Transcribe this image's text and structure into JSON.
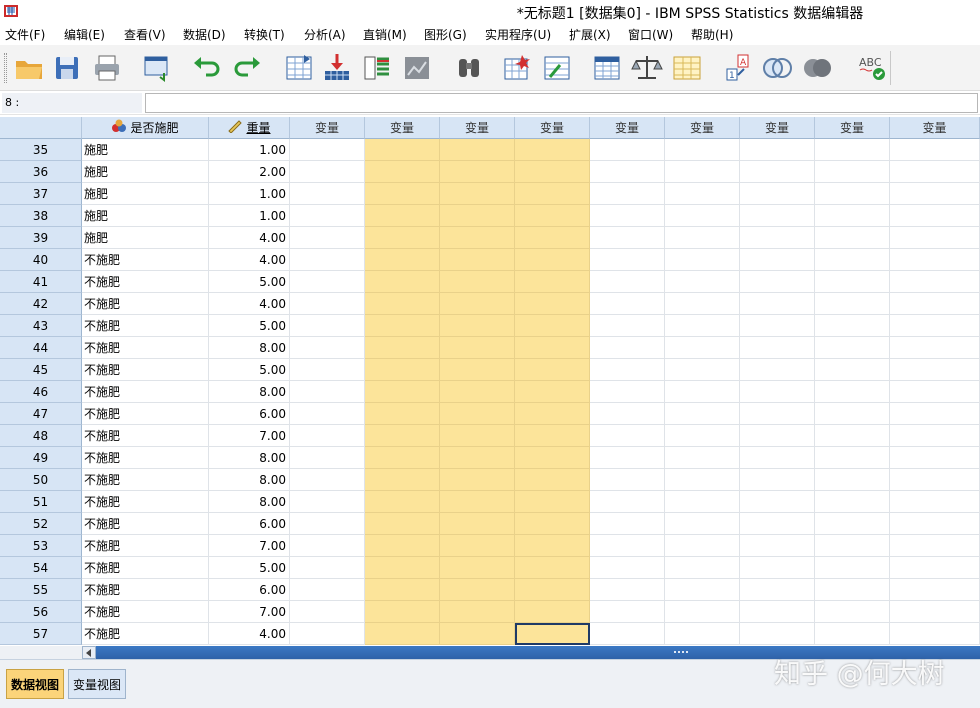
{
  "window": {
    "title": "*无标题1 [数据集0] - IBM SPSS Statistics 数据编辑器"
  },
  "menu": [
    {
      "label": "文件(F)",
      "underline_char": "F"
    },
    {
      "label": "编辑(E)",
      "underline_char": "E"
    },
    {
      "label": "查看(V)",
      "underline_char": "V"
    },
    {
      "label": "数据(D)",
      "underline_char": "D"
    },
    {
      "label": "转换(T)",
      "underline_char": "T"
    },
    {
      "label": "分析(A)",
      "underline_char": "A"
    },
    {
      "label": "直销(M)",
      "underline_char": "M"
    },
    {
      "label": "图形(G)",
      "underline_char": "G"
    },
    {
      "label": "实用程序(U)",
      "underline_char": "U"
    },
    {
      "label": "扩展(X)",
      "underline_char": "X"
    },
    {
      "label": "窗口(W)",
      "underline_char": "W"
    },
    {
      "label": "帮助(H)",
      "underline_char": "H"
    }
  ],
  "toolbar": {
    "buttons": [
      {
        "name": "open-folder-icon"
      },
      {
        "name": "save-disk-icon"
      },
      {
        "name": "print-icon"
      },
      {
        "name": "recall-dialog-icon"
      },
      {
        "name": "undo-icon"
      },
      {
        "name": "redo-icon"
      },
      {
        "name": "goto-case-icon"
      },
      {
        "name": "goto-variable-icon"
      },
      {
        "name": "variables-icon"
      },
      {
        "name": "run-descriptives-icon"
      },
      {
        "name": "find-binoculars-icon"
      },
      {
        "name": "insert-cases-icon"
      },
      {
        "name": "insert-variable-icon"
      },
      {
        "name": "split-file-icon"
      },
      {
        "name": "weight-cases-scale-icon"
      },
      {
        "name": "select-cases-icon"
      },
      {
        "name": "value-labels-icon"
      },
      {
        "name": "use-variable-sets-icon"
      },
      {
        "name": "show-all-variables-icon"
      },
      {
        "name": "spell-check-icon"
      }
    ]
  },
  "cellbar": {
    "reference": "8 :",
    "value": ""
  },
  "grid": {
    "columns": [
      {
        "label": "是否施肥",
        "kind": "nominal",
        "icon": "nominal-variable-icon"
      },
      {
        "label": "重量",
        "kind": "scale",
        "icon": "scale-ruler-icon",
        "underline": true
      },
      {
        "label": "变量"
      },
      {
        "label": "变量"
      },
      {
        "label": "变量"
      },
      {
        "label": "变量"
      },
      {
        "label": "变量"
      },
      {
        "label": "变量"
      },
      {
        "label": "变量"
      },
      {
        "label": "变量"
      },
      {
        "label": "变量"
      }
    ],
    "highlighted_columns": [
      3,
      4,
      5
    ],
    "highlight_color": "#fce49a",
    "selected_cell": {
      "row": 57,
      "col": 5
    },
    "rows": [
      {
        "n": "35",
        "fert": "施肥",
        "weight": "1.00"
      },
      {
        "n": "36",
        "fert": "施肥",
        "weight": "2.00"
      },
      {
        "n": "37",
        "fert": "施肥",
        "weight": "1.00"
      },
      {
        "n": "38",
        "fert": "施肥",
        "weight": "1.00"
      },
      {
        "n": "39",
        "fert": "施肥",
        "weight": "4.00"
      },
      {
        "n": "40",
        "fert": "不施肥",
        "weight": "4.00"
      },
      {
        "n": "41",
        "fert": "不施肥",
        "weight": "5.00"
      },
      {
        "n": "42",
        "fert": "不施肥",
        "weight": "4.00"
      },
      {
        "n": "43",
        "fert": "不施肥",
        "weight": "5.00"
      },
      {
        "n": "44",
        "fert": "不施肥",
        "weight": "8.00"
      },
      {
        "n": "45",
        "fert": "不施肥",
        "weight": "5.00"
      },
      {
        "n": "46",
        "fert": "不施肥",
        "weight": "8.00"
      },
      {
        "n": "47",
        "fert": "不施肥",
        "weight": "6.00"
      },
      {
        "n": "48",
        "fert": "不施肥",
        "weight": "7.00"
      },
      {
        "n": "49",
        "fert": "不施肥",
        "weight": "8.00"
      },
      {
        "n": "50",
        "fert": "不施肥",
        "weight": "8.00"
      },
      {
        "n": "51",
        "fert": "不施肥",
        "weight": "8.00"
      },
      {
        "n": "52",
        "fert": "不施肥",
        "weight": "6.00"
      },
      {
        "n": "53",
        "fert": "不施肥",
        "weight": "7.00"
      },
      {
        "n": "54",
        "fert": "不施肥",
        "weight": "5.00"
      },
      {
        "n": "55",
        "fert": "不施肥",
        "weight": "6.00"
      },
      {
        "n": "56",
        "fert": "不施肥",
        "weight": "7.00"
      },
      {
        "n": "57",
        "fert": "不施肥",
        "weight": "4.00"
      }
    ]
  },
  "tabs": [
    {
      "label": "数据视图",
      "active": true
    },
    {
      "label": "变量视图",
      "active": false
    }
  ],
  "watermark": "知乎 @何大树"
}
